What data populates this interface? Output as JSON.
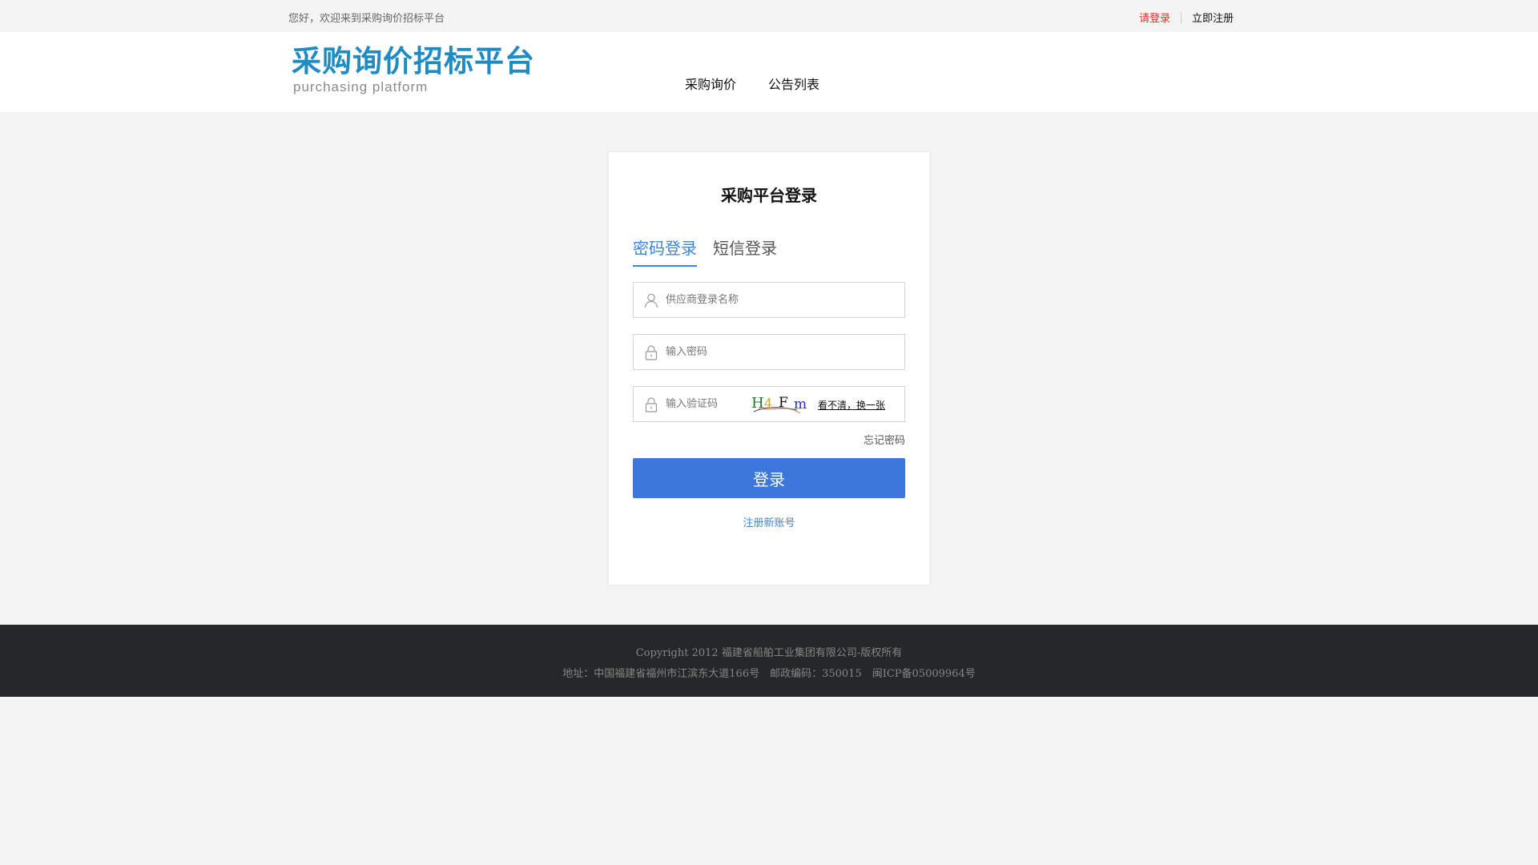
{
  "topbar": {
    "welcome": "您好，欢迎来到采购询价招标平台",
    "login_link": "请登录",
    "register_link": "立即注册"
  },
  "header": {
    "logo_main": "采购询价招标平台",
    "logo_sub": "purchasing platform",
    "nav": [
      "采购询价",
      "公告列表"
    ]
  },
  "login": {
    "title": "采购平台登录",
    "tabs": [
      "密码登录",
      "短信登录"
    ],
    "active_tab": "密码登录",
    "username_placeholder": "供应商登录名称",
    "password_placeholder": "输入密码",
    "captcha_placeholder": "输入验证码",
    "captcha_text": "H4Fm",
    "refresh_captcha": "看不清，换一张",
    "forgot_password": "忘记密码",
    "submit": "登录",
    "register_new": "注册新账号"
  },
  "footer": {
    "copyright": "Copyright 2012 福建省船舶工业集团有限公司-版权所有",
    "address": "地址：中国福建省福州市江滨东大道166号　邮政编码：350015　闽ICP备05009964号"
  },
  "colors": {
    "brand": "#1e8bc3",
    "accent": "#3c78dc",
    "login_link": "#e02e24",
    "footer_bg": "#262729"
  },
  "icons": [
    "user-icon",
    "lock-icon",
    "lock-icon"
  ]
}
